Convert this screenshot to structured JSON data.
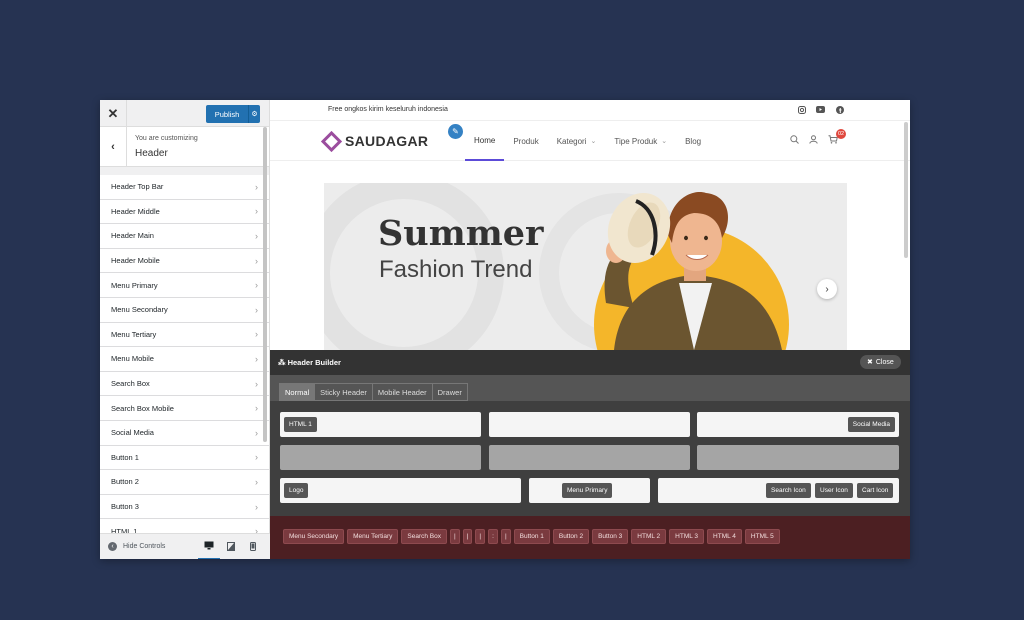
{
  "sidebar": {
    "close_glyph": "✕",
    "publish_label": "Publish",
    "back_glyph": "‹",
    "customizing_label": "You are customizing",
    "section_title": "Header",
    "items": [
      {
        "label": "Header Top Bar"
      },
      {
        "label": "Header Middle"
      },
      {
        "label": "Header Main"
      },
      {
        "label": "Header Mobile"
      },
      {
        "label": "Menu Primary"
      },
      {
        "label": "Menu Secondary"
      },
      {
        "label": "Menu Tertiary"
      },
      {
        "label": "Menu Mobile"
      },
      {
        "label": "Search Box"
      },
      {
        "label": "Search Box Mobile"
      },
      {
        "label": "Social Media"
      },
      {
        "label": "Button 1"
      },
      {
        "label": "Button 2"
      },
      {
        "label": "Button 3"
      },
      {
        "label": "HTML 1"
      }
    ],
    "hide_controls_label": "Hide Controls"
  },
  "preview": {
    "topbar_text": "Free ongkos kirim keseluruh indonesia",
    "logo_text": "SAUDAGAR",
    "menu": [
      {
        "label": "Home",
        "active": true,
        "dropdown": false
      },
      {
        "label": "Produk",
        "active": false,
        "dropdown": false
      },
      {
        "label": "Kategori",
        "active": false,
        "dropdown": true
      },
      {
        "label": "Tipe Produk",
        "active": false,
        "dropdown": true
      },
      {
        "label": "Blog",
        "active": false,
        "dropdown": false
      }
    ],
    "cart_count": "02",
    "hero": {
      "title": "Summer",
      "subtitle": "Fashion Trend"
    },
    "accent_color": "#5c4bd8",
    "brand_color": "#9b4d9e"
  },
  "header_builder": {
    "title": "Header Builder",
    "close_label": "Close",
    "tabs": [
      {
        "label": "Normal",
        "active": true
      },
      {
        "label": "Sticky Header",
        "active": false
      },
      {
        "label": "Mobile Header",
        "active": false
      },
      {
        "label": "Drawer",
        "active": false
      }
    ],
    "top_row": {
      "left": [
        "HTML 1"
      ],
      "center": [],
      "right": [
        "Social Media"
      ]
    },
    "main_row": {
      "left": [
        "Logo"
      ],
      "center": [
        "Menu Primary"
      ],
      "right": [
        "Search Icon",
        "User Icon",
        "Cart Icon"
      ]
    },
    "available": [
      "Menu Secondary",
      "Menu Tertiary",
      "Search Box",
      "|",
      "|",
      "|",
      ":",
      "|",
      "Button 1",
      "Button 2",
      "Button 3",
      "HTML 2",
      "HTML 3",
      "HTML 4",
      "HTML 5"
    ]
  }
}
